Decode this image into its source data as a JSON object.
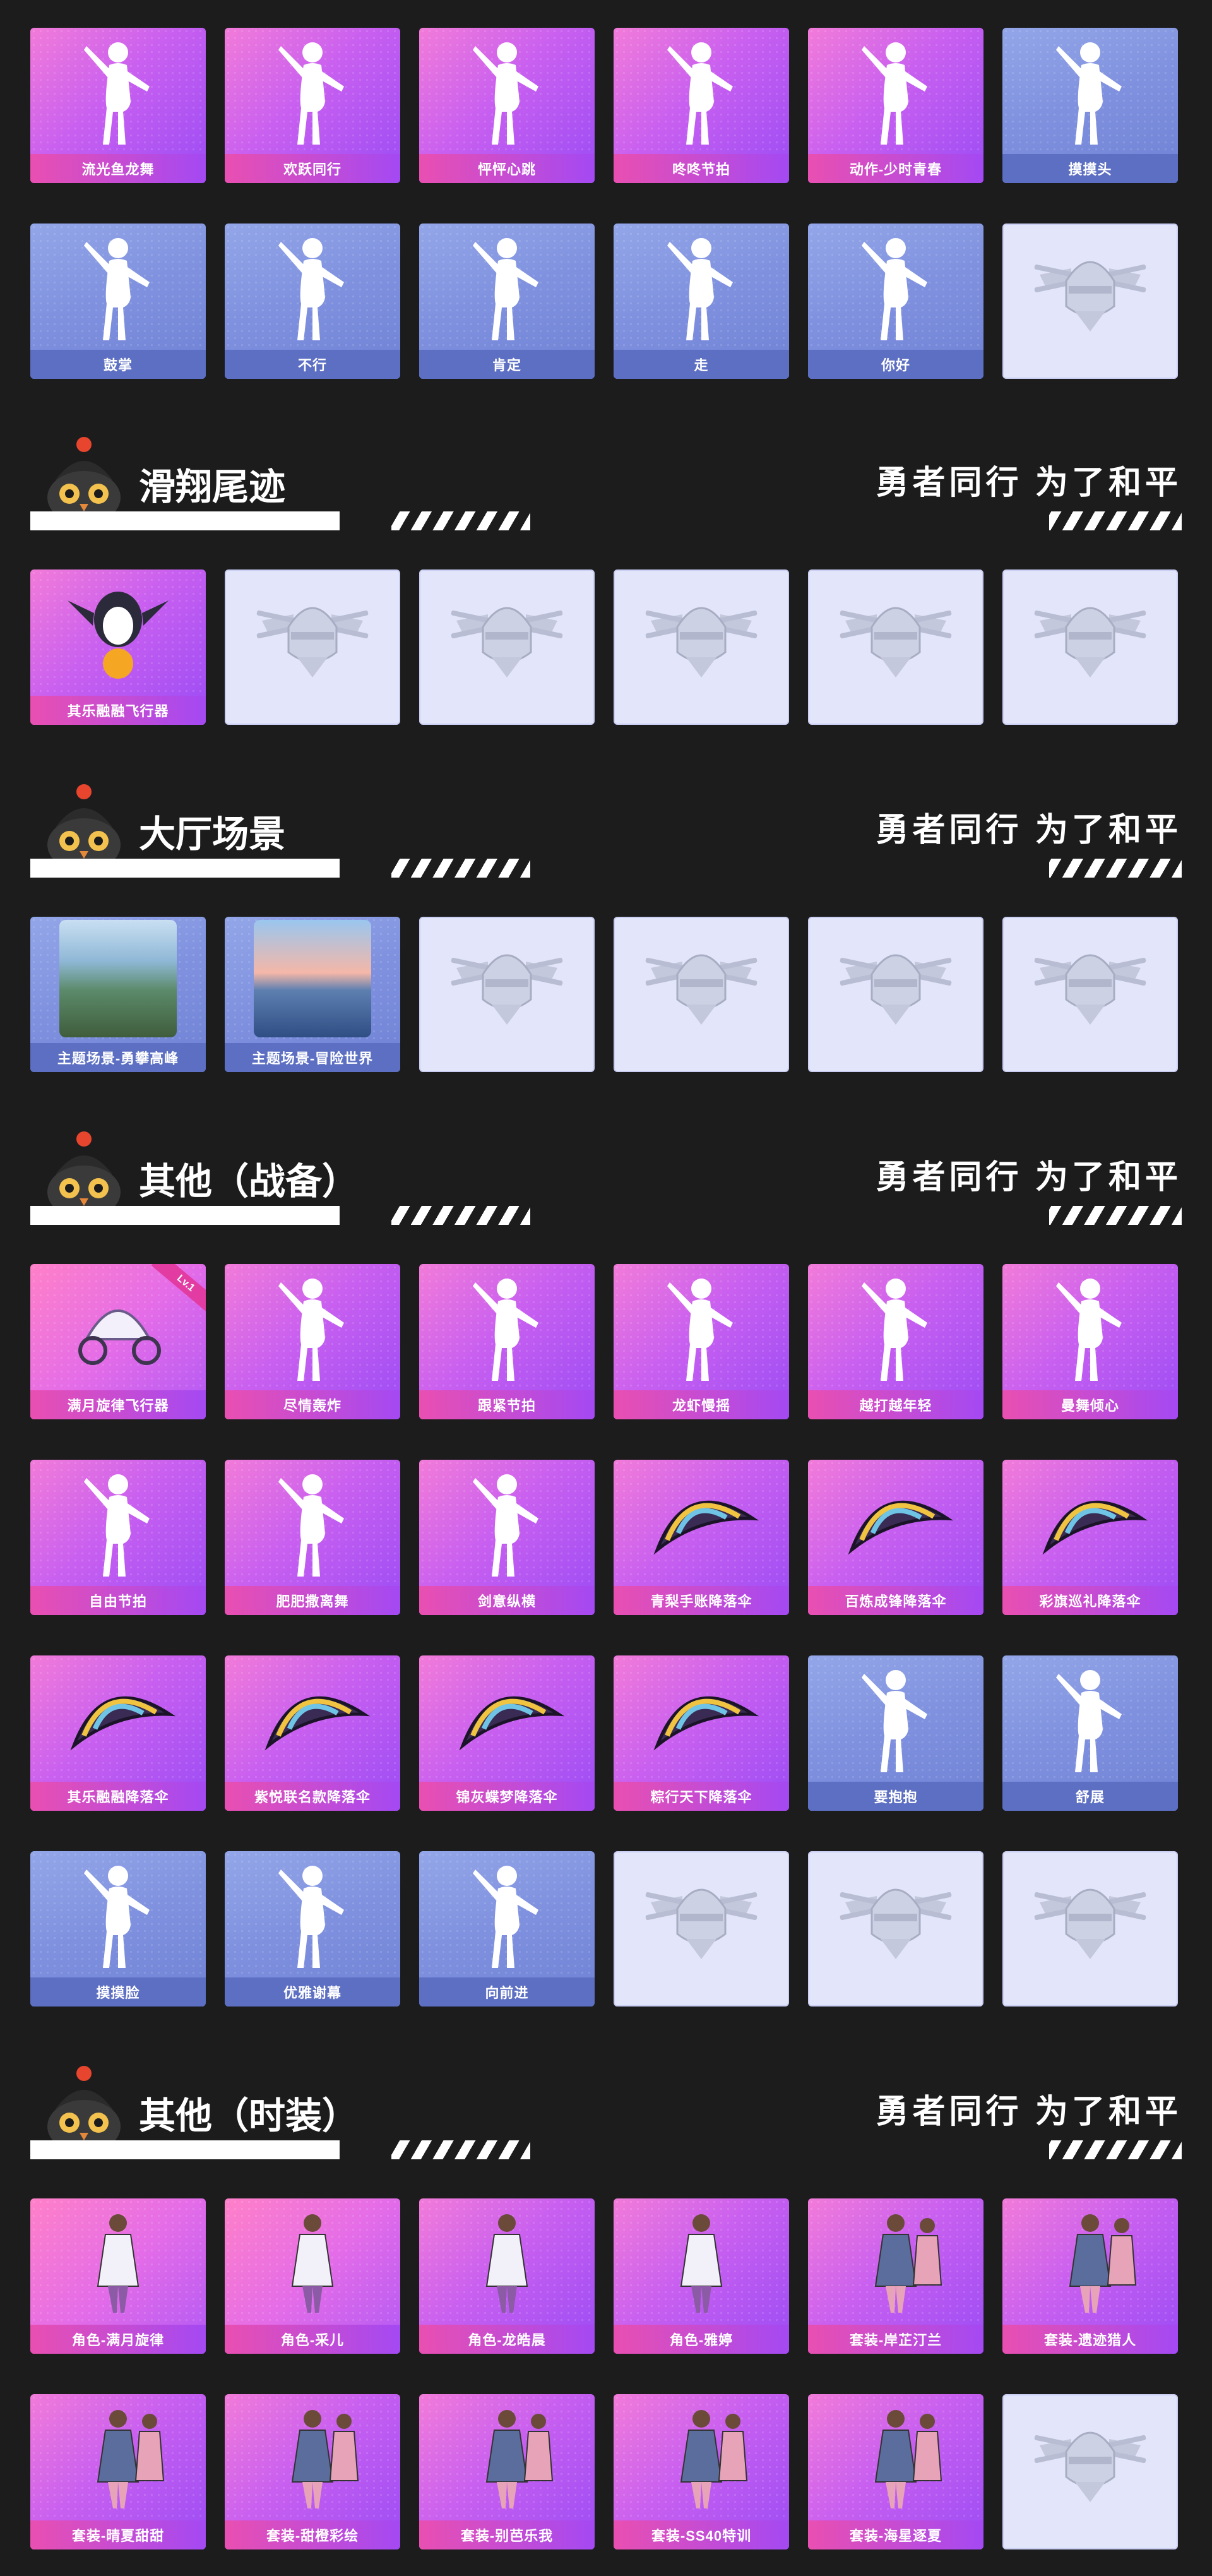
{
  "colors": {
    "background": "#1c1c1d",
    "pink": "#e94fb1",
    "violet": "#a449f3",
    "blue": "#5d6fc2",
    "empty": "#e3e6fa"
  },
  "top_rows": [
    [
      {
        "label": "流光鱼龙舞",
        "style": "pink",
        "icon": "dance-silhouette-icon"
      },
      {
        "label": "欢跃同行",
        "style": "pink",
        "icon": "dance-silhouette-icon"
      },
      {
        "label": "怦怦心跳",
        "style": "pink",
        "icon": "dance-silhouette-icon"
      },
      {
        "label": "咚咚节拍",
        "style": "pink",
        "icon": "dance-silhouette-icon"
      },
      {
        "label": "动作-少时青春",
        "style": "pink",
        "icon": "dance-silhouette-icon"
      },
      {
        "label": "摸摸头",
        "style": "blue",
        "icon": "gesture-silhouette-icon"
      }
    ],
    [
      {
        "label": "鼓掌",
        "style": "blue",
        "icon": "clap-hands-icon"
      },
      {
        "label": "不行",
        "style": "blue",
        "icon": "head-shake-icon"
      },
      {
        "label": "肯定",
        "style": "blue",
        "icon": "head-nod-icon"
      },
      {
        "label": "走",
        "style": "blue",
        "icon": "pointing-hand-icon"
      },
      {
        "label": "你好",
        "style": "blue",
        "icon": "wave-silhouette-icon"
      },
      {
        "label": "",
        "style": "empty",
        "icon": "empty-slot-emblem-icon"
      }
    ]
  ],
  "sections": [
    {
      "title": "滑翔尾迹",
      "slogan": "勇者同行 为了和平",
      "rows": [
        [
          {
            "label": "其乐融融飞行器",
            "style": "pink",
            "icon": "penguin-glider-icon"
          },
          {
            "label": "",
            "style": "empty",
            "icon": "empty-slot-emblem-icon"
          },
          {
            "label": "",
            "style": "empty",
            "icon": "empty-slot-emblem-icon"
          },
          {
            "label": "",
            "style": "empty",
            "icon": "empty-slot-emblem-icon"
          },
          {
            "label": "",
            "style": "empty",
            "icon": "empty-slot-emblem-icon"
          },
          {
            "label": "",
            "style": "empty",
            "icon": "empty-slot-emblem-icon"
          }
        ]
      ]
    },
    {
      "title": "大厅场景",
      "slogan": "勇者同行 为了和平",
      "rows": [
        [
          {
            "label": "主题场景-勇攀高峰",
            "style": "blue",
            "icon": "mountain-scene-icon"
          },
          {
            "label": "主题场景-冒险世界",
            "style": "blue",
            "icon": "sea-scene-icon"
          },
          {
            "label": "",
            "style": "empty",
            "icon": "empty-slot-emblem-icon"
          },
          {
            "label": "",
            "style": "empty",
            "icon": "empty-slot-emblem-icon"
          },
          {
            "label": "",
            "style": "empty",
            "icon": "empty-slot-emblem-icon"
          },
          {
            "label": "",
            "style": "empty",
            "icon": "empty-slot-emblem-icon"
          }
        ]
      ]
    },
    {
      "title": "其他（战备）",
      "slogan": "勇者同行 为了和平",
      "rows": [
        [
          {
            "label": "满月旋律飞行器",
            "style": "hot",
            "icon": "carriage-glider-icon",
            "badge": "Lv.1"
          },
          {
            "label": "尽情轰炸",
            "style": "pink",
            "icon": "dance-silhouette-icon"
          },
          {
            "label": "跟紧节拍",
            "style": "pink",
            "icon": "dance-silhouette-icon"
          },
          {
            "label": "龙虾慢摇",
            "style": "pink",
            "icon": "dance-silhouette-icon"
          },
          {
            "label": "越打越年轻",
            "style": "pink",
            "icon": "dance-silhouette-icon"
          },
          {
            "label": "曼舞倾心",
            "style": "pink",
            "icon": "dance-silhouette-icon"
          }
        ],
        [
          {
            "label": "自由节拍",
            "style": "pink",
            "icon": "dance-silhouette-icon"
          },
          {
            "label": "肥肥撒离舞",
            "style": "pink",
            "icon": "dance-silhouette-icon"
          },
          {
            "label": "剑意纵横",
            "style": "pink",
            "icon": "sword-dance-icon"
          },
          {
            "label": "青梨手账降落伞",
            "style": "pink",
            "icon": "parachute-icon"
          },
          {
            "label": "百炼成锋降落伞",
            "style": "pink",
            "icon": "parachute-icon"
          },
          {
            "label": "彩旗巡礼降落伞",
            "style": "pink",
            "icon": "parachute-icon"
          }
        ],
        [
          {
            "label": "其乐融融降落伞",
            "style": "pink",
            "icon": "parachute-icon"
          },
          {
            "label": "紫悦联名款降落伞",
            "style": "pink",
            "icon": "parachute-icon"
          },
          {
            "label": "锦灰蝶梦降落伞",
            "style": "pink",
            "icon": "parachute-icon"
          },
          {
            "label": "粽行天下降落伞",
            "style": "pink",
            "icon": "parachute-icon"
          },
          {
            "label": "要抱抱",
            "style": "blue",
            "icon": "hug-silhouette-icon"
          },
          {
            "label": "舒展",
            "style": "blue",
            "icon": "stretch-silhouette-icon"
          }
        ],
        [
          {
            "label": "摸摸脸",
            "style": "blue",
            "icon": "gesture-silhouette-icon"
          },
          {
            "label": "优雅谢幕",
            "style": "blue",
            "icon": "bow-silhouette-icon"
          },
          {
            "label": "向前进",
            "style": "blue",
            "icon": "march-silhouette-icon"
          },
          {
            "label": "",
            "style": "empty",
            "icon": "empty-slot-emblem-icon"
          },
          {
            "label": "",
            "style": "empty",
            "icon": "empty-slot-emblem-icon"
          },
          {
            "label": "",
            "style": "empty",
            "icon": "empty-slot-emblem-icon"
          }
        ]
      ]
    },
    {
      "title": "其他（时装）",
      "slogan": "勇者同行 为了和平",
      "rows": [
        [
          {
            "label": "角色-满月旋律",
            "style": "hot",
            "icon": "character-outfit-icon"
          },
          {
            "label": "角色-采儿",
            "style": "hot",
            "icon": "character-outfit-icon"
          },
          {
            "label": "角色-龙皓晨",
            "style": "pink",
            "icon": "character-outfit-icon"
          },
          {
            "label": "角色-雅婷",
            "style": "pink",
            "icon": "character-outfit-icon"
          },
          {
            "label": "套装-岸芷汀兰",
            "style": "pink",
            "icon": "outfit-set-icon"
          },
          {
            "label": "套装-遗迹猎人",
            "style": "pink",
            "icon": "outfit-set-icon"
          }
        ],
        [
          {
            "label": "套装-晴夏甜甜",
            "style": "pink",
            "icon": "outfit-set-icon"
          },
          {
            "label": "套装-甜橙彩绘",
            "style": "pink",
            "icon": "outfit-set-icon"
          },
          {
            "label": "套装-别芭乐我",
            "style": "pink",
            "icon": "outfit-set-icon"
          },
          {
            "label": "套装-SS40特训",
            "style": "pink",
            "icon": "outfit-set-icon"
          },
          {
            "label": "套装-海星逐夏",
            "style": "pink",
            "icon": "outfit-set-icon"
          },
          {
            "label": "",
            "style": "empty",
            "icon": "empty-slot-emblem-icon"
          }
        ]
      ]
    }
  ]
}
